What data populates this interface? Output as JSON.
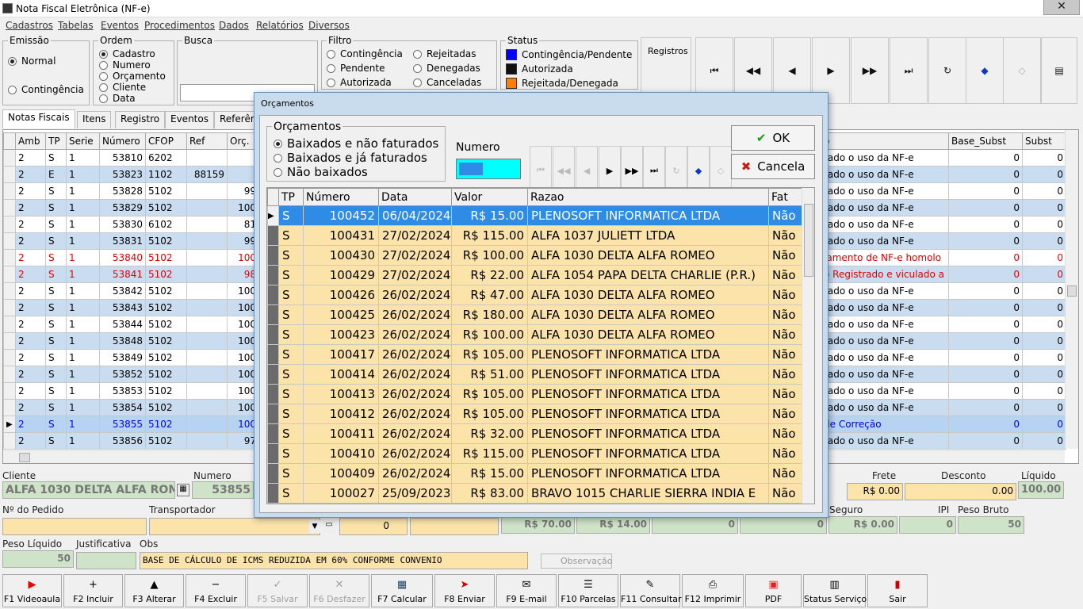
{
  "window": {
    "title": "Nota Fiscal Eletrônica (NF-e)",
    "close_label": "✕"
  },
  "menu": [
    "Cadastros",
    "Tabelas",
    "Eventos",
    "Procedimentos",
    "Dados",
    "Relatórios",
    "Diversos"
  ],
  "emissao": {
    "legend": "Emissão",
    "options": [
      "Normal",
      "Contingência"
    ],
    "selected": "Normal"
  },
  "ordem": {
    "legend": "Ordem",
    "options": [
      "Cadastro",
      "Numero",
      "Orçamento",
      "Cliente",
      "Data"
    ],
    "selected": "Cadastro"
  },
  "busca": {
    "legend": "Busca",
    "value": ""
  },
  "filtro": {
    "legend": "Filtro",
    "options": [
      "Contingência",
      "Pendente",
      "Autorizada",
      "Rejeitadas",
      "Denegadas",
      "Canceladas"
    ]
  },
  "status": {
    "legend": "Status",
    "items": [
      {
        "label": "Contingência/Pendente",
        "color": "#0000ff"
      },
      {
        "label": "Autorizada",
        "color": "#111111"
      },
      {
        "label": "Rejeitada/Denegada",
        "color": "#ff8000"
      }
    ]
  },
  "registros_label": "Registros",
  "nav_icons": [
    "first-icon",
    "prior-page-icon",
    "prior-icon",
    "next-icon",
    "next-page-icon",
    "last-icon",
    "refresh-icon",
    "bookmark-icon",
    "goto-icon",
    "grid-config-icon"
  ],
  "tabs": [
    "Notas Fiscais",
    "Itens",
    "Registro",
    "Eventos",
    "Referên"
  ],
  "main_grid": {
    "columns": [
      "Amb",
      "TP",
      "Serie",
      "Número",
      "CFOP",
      "Ref",
      "Orç."
    ],
    "right_columns": [
      "o",
      "Base_Subst",
      "Subst"
    ],
    "rows": [
      {
        "amb": "2",
        "tp": "S",
        "serie": "1",
        "numero": "53810",
        "cfop": "6202",
        "ref": "",
        "orc": "",
        "msg": "rado o uso da NF-e",
        "base": "0",
        "subst": "0",
        "color": "black"
      },
      {
        "amb": "2",
        "tp": "E",
        "serie": "1",
        "numero": "53823",
        "cfop": "1102",
        "ref": "88159",
        "orc": "",
        "msg": "rado o uso da NF-e",
        "base": "0",
        "subst": "0",
        "color": "black"
      },
      {
        "amb": "2",
        "tp": "S",
        "serie": "1",
        "numero": "53828",
        "cfop": "5102",
        "ref": "",
        "orc": "99",
        "msg": "rado o uso da NF-e",
        "base": "0",
        "subst": "0",
        "color": "black"
      },
      {
        "amb": "2",
        "tp": "S",
        "serie": "1",
        "numero": "53829",
        "cfop": "5102",
        "ref": "",
        "orc": "100",
        "msg": "rado o uso da NF-e",
        "base": "0",
        "subst": "0",
        "color": "black"
      },
      {
        "amb": "2",
        "tp": "S",
        "serie": "1",
        "numero": "53830",
        "cfop": "6102",
        "ref": "",
        "orc": "81",
        "msg": "rado o uso da NF-e",
        "base": "0",
        "subst": "0",
        "color": "black"
      },
      {
        "amb": "2",
        "tp": "S",
        "serie": "1",
        "numero": "53831",
        "cfop": "5102",
        "ref": "",
        "orc": "99",
        "msg": "rado o uso da NF-e",
        "base": "0",
        "subst": "0",
        "color": "black"
      },
      {
        "amb": "2",
        "tp": "S",
        "serie": "1",
        "numero": "53840",
        "cfop": "5102",
        "ref": "",
        "orc": "100",
        "msg": "lamento de NF-e homolo",
        "base": "0",
        "subst": "0",
        "color": "red"
      },
      {
        "amb": "2",
        "tp": "S",
        "serie": "1",
        "numero": "53841",
        "cfop": "5102",
        "ref": "",
        "orc": "98",
        "msg": "o Registrado e viculado a",
        "base": "0",
        "subst": "0",
        "color": "red"
      },
      {
        "amb": "2",
        "tp": "S",
        "serie": "1",
        "numero": "53842",
        "cfop": "5102",
        "ref": "",
        "orc": "100",
        "msg": "rado o uso da NF-e",
        "base": "0",
        "subst": "0",
        "color": "black"
      },
      {
        "amb": "2",
        "tp": "S",
        "serie": "1",
        "numero": "53843",
        "cfop": "5102",
        "ref": "",
        "orc": "100",
        "msg": "rado o uso da NF-e",
        "base": "0",
        "subst": "0",
        "color": "black"
      },
      {
        "amb": "2",
        "tp": "S",
        "serie": "1",
        "numero": "53844",
        "cfop": "5102",
        "ref": "",
        "orc": "100",
        "msg": "rado o uso da NF-e",
        "base": "0",
        "subst": "0",
        "color": "black"
      },
      {
        "amb": "2",
        "tp": "S",
        "serie": "1",
        "numero": "53848",
        "cfop": "5102",
        "ref": "",
        "orc": "100",
        "msg": "rado o uso da NF-e",
        "base": "0",
        "subst": "0",
        "color": "black"
      },
      {
        "amb": "2",
        "tp": "S",
        "serie": "1",
        "numero": "53849",
        "cfop": "5102",
        "ref": "",
        "orc": "100",
        "msg": "rado o uso da NF-e",
        "base": "0",
        "subst": "0",
        "color": "black"
      },
      {
        "amb": "2",
        "tp": "S",
        "serie": "1",
        "numero": "53852",
        "cfop": "5102",
        "ref": "",
        "orc": "100",
        "msg": "rado o uso da NF-e",
        "base": "0",
        "subst": "0",
        "color": "black"
      },
      {
        "amb": "2",
        "tp": "S",
        "serie": "1",
        "numero": "53853",
        "cfop": "5102",
        "ref": "",
        "orc": "100",
        "msg": "rado o uso da NF-e",
        "base": "0",
        "subst": "0",
        "color": "black"
      },
      {
        "amb": "2",
        "tp": "S",
        "serie": "1",
        "numero": "53854",
        "cfop": "5102",
        "ref": "",
        "orc": "100",
        "msg": "rado o uso da NF-e",
        "base": "0",
        "subst": "0",
        "color": "black"
      },
      {
        "amb": "2",
        "tp": "S",
        "serie": "1",
        "numero": "53855",
        "cfop": "5102",
        "ref": "",
        "orc": "100",
        "msg": "de Correção",
        "base": "0",
        "subst": "0",
        "color": "blue",
        "current": true
      },
      {
        "amb": "2",
        "tp": "S",
        "serie": "1",
        "numero": "53856",
        "cfop": "5102",
        "ref": "",
        "orc": "97",
        "msg": "rado o uso da NF-e",
        "base": "0",
        "subst": "0",
        "color": "black"
      }
    ]
  },
  "form": {
    "cliente_label": "Cliente",
    "cliente_value": "ALFA 1030 DELTA ALFA ROMEO",
    "numero_label": "Numero",
    "numero_value": "53855",
    "frete_label": "Frete",
    "frete_value": "R$ 0.00",
    "desconto_label": "Desconto",
    "desconto_value": "0.00",
    "liquido_label": "Líquido",
    "liquido_value": "100.00",
    "pedido_label": "Nº do Pedido",
    "pedido_value": "",
    "transportador_label": "Transportador",
    "transportador_value": "",
    "zero_value": "0",
    "seguro_label": "Seguro",
    "ipi_label": "IPI",
    "peso_bruto_label": "Peso Bruto",
    "valor_a": "R$ 70.00",
    "valor_b": "R$ 14.00",
    "valor_c": "0",
    "valor_d": "0",
    "seguro_value": "R$ 0.00",
    "ipi_value": "0",
    "peso_bruto_value": "50",
    "peso_liquido_label": "Peso Líquido",
    "peso_liquido_value": "50",
    "justificativa_label": "Justificativa",
    "justificativa_value": "",
    "obs_label": "Obs",
    "obs_value": "BASE DE CÁLCULO DE ICMS REDUZIDA EM  60%  CONFORME  CONVENIO",
    "observacao_button": "Observação"
  },
  "toolbar": [
    {
      "key": "F1",
      "label": "F1 Videoaula",
      "icon": "youtube-icon",
      "enabled": true
    },
    {
      "key": "F2",
      "label": "F2 Incluir",
      "icon": "plus-icon",
      "enabled": true
    },
    {
      "key": "F3",
      "label": "F3 Alterar",
      "icon": "caret-up-icon",
      "enabled": true
    },
    {
      "key": "F4",
      "label": "F4 Excluir",
      "icon": "minus-icon",
      "enabled": true
    },
    {
      "key": "F5",
      "label": "F5 Salvar",
      "icon": "check-icon",
      "enabled": false
    },
    {
      "key": "F6",
      "label": "F6 Desfazer",
      "icon": "x-icon",
      "enabled": false
    },
    {
      "key": "F7",
      "label": "F7 Calcular",
      "icon": "calculator-icon",
      "enabled": true
    },
    {
      "key": "F8",
      "label": "F8 Enviar",
      "icon": "send-icon",
      "enabled": true
    },
    {
      "key": "F9",
      "label": "F9 E-mail",
      "icon": "mail-icon",
      "enabled": true
    },
    {
      "key": "F10",
      "label": "F10 Parcelas",
      "icon": "list-icon",
      "enabled": true
    },
    {
      "key": "F11",
      "label": "F11 Consultar",
      "icon": "consult-icon",
      "enabled": true
    },
    {
      "key": "F12",
      "label": "F12 Imprimir",
      "icon": "printer-icon",
      "enabled": true
    },
    {
      "key": "PDF",
      "label": "PDF",
      "icon": "pdf-icon",
      "enabled": true
    },
    {
      "key": "Status",
      "label": "Status Serviço",
      "icon": "server-icon",
      "enabled": true
    },
    {
      "key": "Sair",
      "label": "Sair",
      "icon": "exit-icon",
      "enabled": true
    }
  ],
  "dialog": {
    "title": "Orçamentos",
    "group_legend": "Orçamentos",
    "options": [
      "Baixados e não faturados",
      "Baixados e já faturados",
      "Não baixados"
    ],
    "selected": "Baixados e não faturados",
    "numero_label": "Numero",
    "ok_label": "OK",
    "cancel_label": "Cancela",
    "columns": [
      "TP",
      "Número",
      "Data",
      "Valor",
      "Razao",
      "Fat"
    ],
    "rows": [
      {
        "tp": "S",
        "numero": "100452",
        "data": "06/04/2024",
        "valor": "R$ 15.00",
        "razao": "PLENOSOFT INFORMATICA LTDA",
        "fat": "Não",
        "selected": true
      },
      {
        "tp": "S",
        "numero": "100431",
        "data": "27/02/2024",
        "valor": "R$ 115.00",
        "razao": "ALFA 1037 JULIETT LTDA",
        "fat": "Não"
      },
      {
        "tp": "S",
        "numero": "100430",
        "data": "27/02/2024",
        "valor": "R$ 100.00",
        "razao": "ALFA 1030 DELTA ALFA ROMEO",
        "fat": "Não"
      },
      {
        "tp": "S",
        "numero": "100429",
        "data": "27/02/2024",
        "valor": "R$ 22.00",
        "razao": "ALFA 1054 PAPA DELTA CHARLIE (P.R.)",
        "fat": "Não"
      },
      {
        "tp": "S",
        "numero": "100426",
        "data": "26/02/2024",
        "valor": "R$ 47.00",
        "razao": "ALFA 1030 DELTA ALFA ROMEO",
        "fat": "Não"
      },
      {
        "tp": "S",
        "numero": "100425",
        "data": "26/02/2024",
        "valor": "R$ 180.00",
        "razao": "ALFA 1030 DELTA ALFA ROMEO",
        "fat": "Não"
      },
      {
        "tp": "S",
        "numero": "100423",
        "data": "26/02/2024",
        "valor": "R$ 100.00",
        "razao": "ALFA 1030 DELTA ALFA ROMEO",
        "fat": "Não"
      },
      {
        "tp": "S",
        "numero": "100417",
        "data": "26/02/2024",
        "valor": "R$ 105.00",
        "razao": "PLENOSOFT INFORMATICA LTDA",
        "fat": "Não"
      },
      {
        "tp": "S",
        "numero": "100414",
        "data": "26/02/2024",
        "valor": "R$ 51.00",
        "razao": "PLENOSOFT INFORMATICA LTDA",
        "fat": "Não"
      },
      {
        "tp": "S",
        "numero": "100413",
        "data": "26/02/2024",
        "valor": "R$ 105.00",
        "razao": "PLENOSOFT INFORMATICA LTDA",
        "fat": "Não"
      },
      {
        "tp": "S",
        "numero": "100412",
        "data": "26/02/2024",
        "valor": "R$ 105.00",
        "razao": "PLENOSOFT INFORMATICA LTDA",
        "fat": "Não"
      },
      {
        "tp": "S",
        "numero": "100411",
        "data": "26/02/2024",
        "valor": "R$ 32.00",
        "razao": "PLENOSOFT INFORMATICA LTDA",
        "fat": "Não"
      },
      {
        "tp": "S",
        "numero": "100410",
        "data": "26/02/2024",
        "valor": "R$ 115.00",
        "razao": "PLENOSOFT INFORMATICA LTDA",
        "fat": "Não"
      },
      {
        "tp": "S",
        "numero": "100409",
        "data": "26/02/2024",
        "valor": "R$ 15.00",
        "razao": "PLENOSOFT INFORMATICA LTDA",
        "fat": "Não"
      },
      {
        "tp": "S",
        "numero": "100027",
        "data": "25/09/2023",
        "valor": "R$ 83.00",
        "razao": "BRAVO 1015 CHARLIE SIERRA INDIA E",
        "fat": "Não"
      }
    ]
  }
}
